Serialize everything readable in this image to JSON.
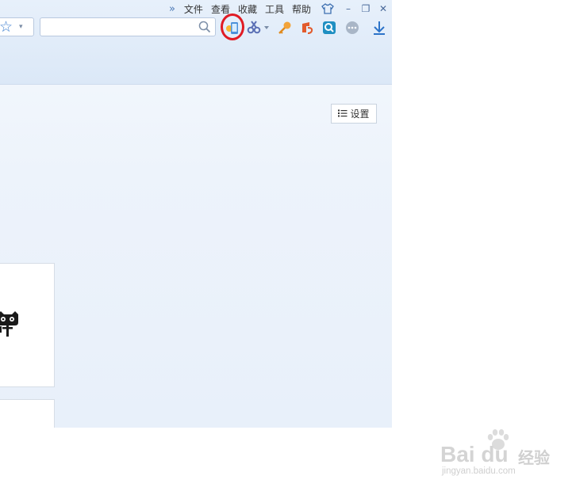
{
  "menubar": {
    "more_label": "»",
    "items": [
      "文件",
      "查看",
      "收藏",
      "工具",
      "帮助"
    ],
    "minimize_label": "–",
    "restore_label": "❐",
    "close_label": "✕"
  },
  "toolbar": {
    "favorites_caret": "▾",
    "search_value": "",
    "icons": [
      "favorites-star-icon",
      "search-icon",
      "phone-sync-icon",
      "scissors-icon",
      "key-icon",
      "weibo-icon",
      "reader-icon",
      "more-dots-icon",
      "download-icon"
    ]
  },
  "page": {
    "settings_label": "设置"
  },
  "watermark": {
    "logo": "Bai du",
    "cn": "经验",
    "url": "jingyan.baidu.com"
  },
  "colors": {
    "highlight_ring": "#e01b24",
    "accent_blue": "#3d7fd0",
    "chrome_bg": "#dbe8f7"
  }
}
